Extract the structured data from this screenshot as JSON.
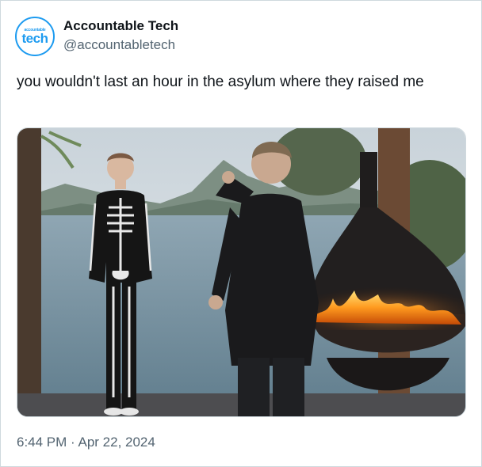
{
  "author": {
    "avatar_small_text": "accountable",
    "avatar_big_text": "tech",
    "display_name": "Accountable Tech",
    "handle": "@accountabletech"
  },
  "tweet": {
    "text": "you wouldn't last an hour in the asylum where they raised me",
    "timestamp": "6:44 PM · Apr 22, 2024"
  },
  "colors": {
    "accent": "#1d9bf0",
    "text_primary": "#0f1419",
    "text_secondary": "#536471",
    "border": "#cfd9de"
  }
}
